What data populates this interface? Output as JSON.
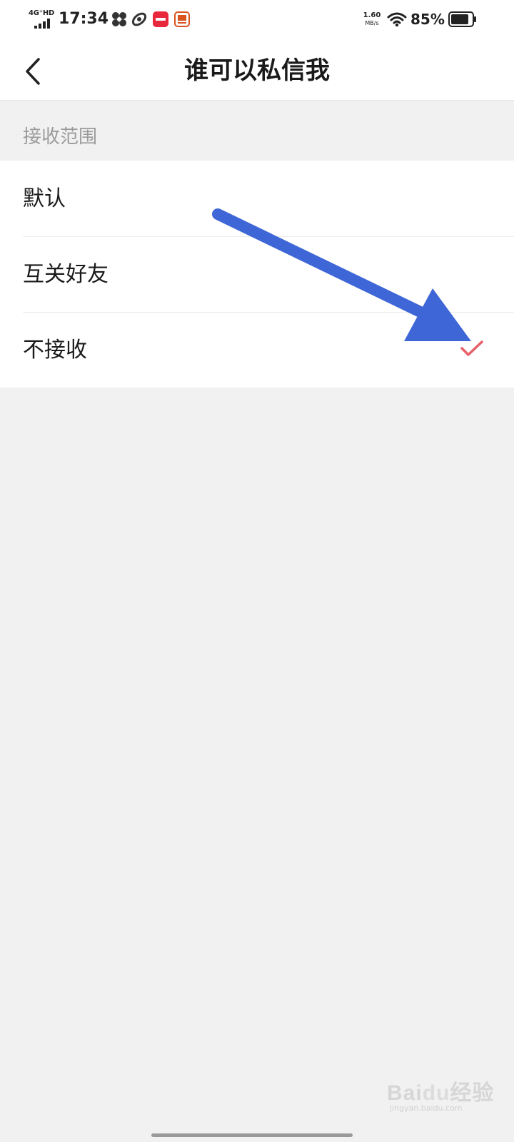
{
  "status_bar": {
    "network_type": "4G⁺HD",
    "time": "17:34",
    "app_icons": [
      "fan-app-icon",
      "swirl-app-icon",
      "red-store-app-icon",
      "orange-news-app-icon"
    ],
    "speed_value": "1.60",
    "speed_unit": "MB/s",
    "battery_percent": "85%",
    "battery_level": 0.85
  },
  "header": {
    "back_icon": "chevron-left-icon",
    "title": "谁可以私信我"
  },
  "section": {
    "title": "接收范围"
  },
  "options": [
    {
      "label": "默认",
      "selected": false
    },
    {
      "label": "互关好友",
      "selected": false
    },
    {
      "label": "不接收",
      "selected": true
    }
  ],
  "colors": {
    "check": "#e8606a",
    "arrow": "#3e66d6",
    "page_background": "#f1f1f1",
    "secondary_text": "#9b9b9b"
  },
  "watermark": {
    "brand": "Bai",
    "brand_tail": "经验",
    "url": "jingyan.baidu.com"
  }
}
